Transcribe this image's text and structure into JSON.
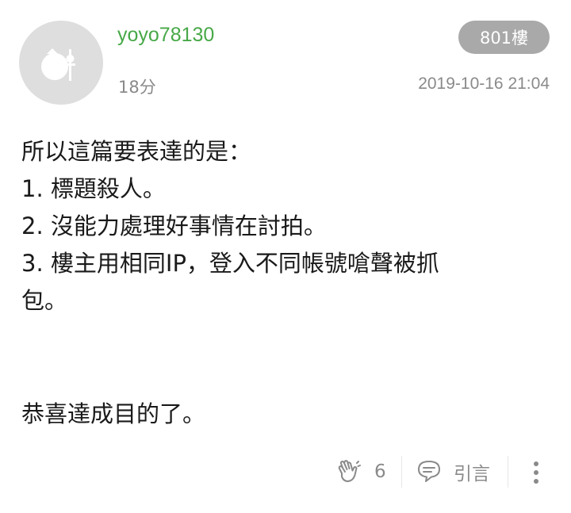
{
  "post": {
    "username": "yoyo78130",
    "floor_badge": "801樓",
    "elapsed": "18分",
    "datetime": "2019-10-16 21:04",
    "lines": [
      "所以這篇要表達的是：",
      "1. 標題殺人。",
      "2. 沒能力處理好事情在討拍。",
      "3. 樓主用相同IP，登入不同帳號嗆聲被抓",
      "包。"
    ],
    "closing": "恭喜達成目的了。"
  },
  "actions": {
    "like_count": "6",
    "quote_label": "引言"
  },
  "icons": {
    "avatar": "default-avatar-icon",
    "like": "clap-hands-icon",
    "quote": "speech-bubble-icon",
    "more": "more-vertical-icon"
  },
  "colors": {
    "username": "#47a847",
    "badge_bg": "#a9a9a9",
    "meta_text": "#8a8a8a"
  }
}
